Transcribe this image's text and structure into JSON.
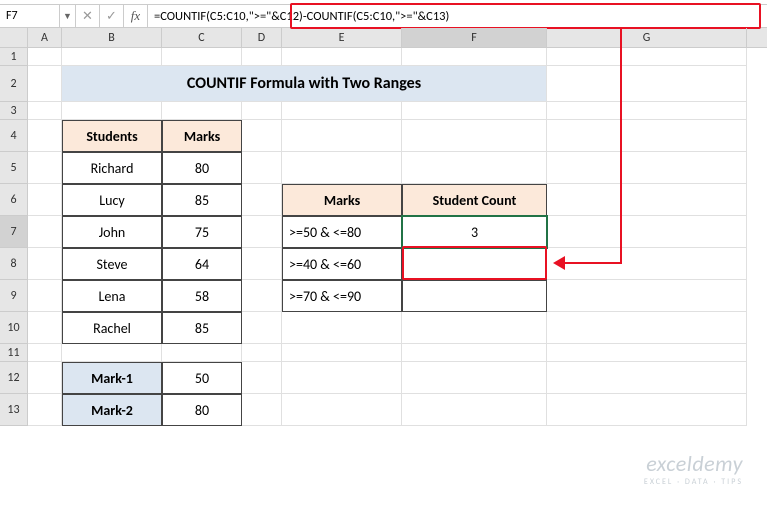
{
  "namebox": "F7",
  "formula": "=COUNTIF(C5:C10,\">=\"&C12)-COUNTIF(C5:C10,\">=\"&C13)",
  "columns": [
    "A",
    "B",
    "C",
    "D",
    "E",
    "F",
    "G"
  ],
  "rows": [
    "1",
    "2",
    "3",
    "4",
    "5",
    "6",
    "7",
    "8",
    "9",
    "10",
    "11",
    "12",
    "13"
  ],
  "title": "COUNTIF Formula with Two Ranges",
  "students_header": {
    "col1": "Students",
    "col2": "Marks"
  },
  "students": [
    {
      "name": "Richard",
      "marks": 80
    },
    {
      "name": "Lucy",
      "marks": 85
    },
    {
      "name": "John",
      "marks": 75
    },
    {
      "name": "Steve",
      "marks": 64
    },
    {
      "name": "Lena",
      "marks": 58
    },
    {
      "name": "Rachel",
      "marks": 85
    }
  ],
  "criteria_header": {
    "col1": "Marks",
    "col2": "Student Count"
  },
  "criteria": [
    {
      "label": ">=50 & <=80",
      "count": 3
    },
    {
      "label": ">=40 & <=60",
      "count": ""
    },
    {
      "label": ">=70 & <=90",
      "count": ""
    }
  ],
  "mark_labels": {
    "m1": "Mark-1",
    "m2": "Mark-2"
  },
  "mark_values": {
    "m1": 50,
    "m2": 80
  },
  "watermark": {
    "line1": "exceldemy",
    "line2": "EXCEL · DATA · TIPS"
  },
  "icons": {
    "dropdown": "▼",
    "cancel": "✕",
    "confirm": "✓",
    "fx": "fx"
  }
}
